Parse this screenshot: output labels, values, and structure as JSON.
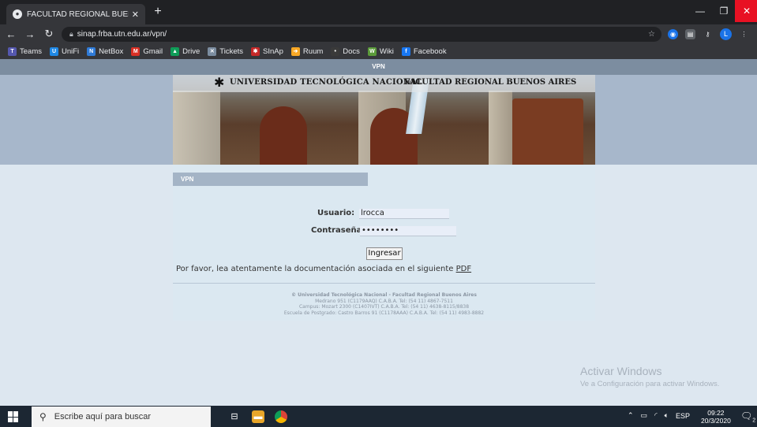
{
  "browser": {
    "tab_title": "FACULTAD REGIONAL BUENOS A",
    "tab_close": "✕",
    "new_tab": "+",
    "url": "sinap.frba.utn.edu.ar/vpn/",
    "window_min": "—",
    "window_max": "❐",
    "window_close": "✕",
    "profile_initial": "L"
  },
  "bookmarks": [
    {
      "label": "Teams",
      "color": "#5558af",
      "glyph": "T"
    },
    {
      "label": "UniFi",
      "color": "#1e88e5",
      "glyph": "U"
    },
    {
      "label": "NetBox",
      "color": "#2f7bd8",
      "glyph": "N"
    },
    {
      "label": "Gmail",
      "color": "#d93025",
      "glyph": "M"
    },
    {
      "label": "Drive",
      "color": "#0f9d58",
      "glyph": "▲"
    },
    {
      "label": "Tickets",
      "color": "#7c8da0",
      "glyph": "✕"
    },
    {
      "label": "SInAp",
      "color": "#c62828",
      "glyph": "✱"
    },
    {
      "label": "Ruum",
      "color": "#f9a825",
      "glyph": "➔"
    },
    {
      "label": "Docs",
      "color": "#3a3a3a",
      "glyph": "•"
    },
    {
      "label": "Wiki",
      "color": "#5b9b3a",
      "glyph": "W"
    },
    {
      "label": "Facebook",
      "color": "#1877f2",
      "glyph": "f"
    }
  ],
  "page": {
    "topbar": "VPN",
    "logo_glyph": "✱",
    "university": "UNIVERSIDAD TECNOLÓGICA NACIONAL",
    "faculty": "FACULTAD REGIONAL BUENOS AIRES",
    "panel_header": "VPN",
    "usuario_label": "Usuario:",
    "usuario_value": "lrocca",
    "password_label": "Contraseña:",
    "password_value": "••••••••",
    "submit": "Ingresar",
    "note_text": "Por favor, lea atentamente la documentación asociada en el siguiente ",
    "note_link": "PDF",
    "footer": [
      "© Universidad Tecnológica Nacional - Facultad Regional Buenos Aires",
      "Medrano 951 (C1179AAQ) C.A.B.A. Tel: (54 11) 4867-7511",
      "Campus: Mozart 2300 (C1407IVT) C.A.B.A. Tel: (54 11) 4638-8115/8838",
      "Escuela de Postgrado: Castro Barros 91 (C1178AAA) C.A.B.A. Tel: (54 11) 4983-8882"
    ]
  },
  "watermark": {
    "title": "Activar Windows",
    "subtitle": "Ve a Configuración para activar Windows."
  },
  "taskbar": {
    "search_placeholder": "Escribe aquí para buscar",
    "language": "ESP",
    "time": "09:22",
    "date": "20/3/2020",
    "notifications": "2"
  }
}
